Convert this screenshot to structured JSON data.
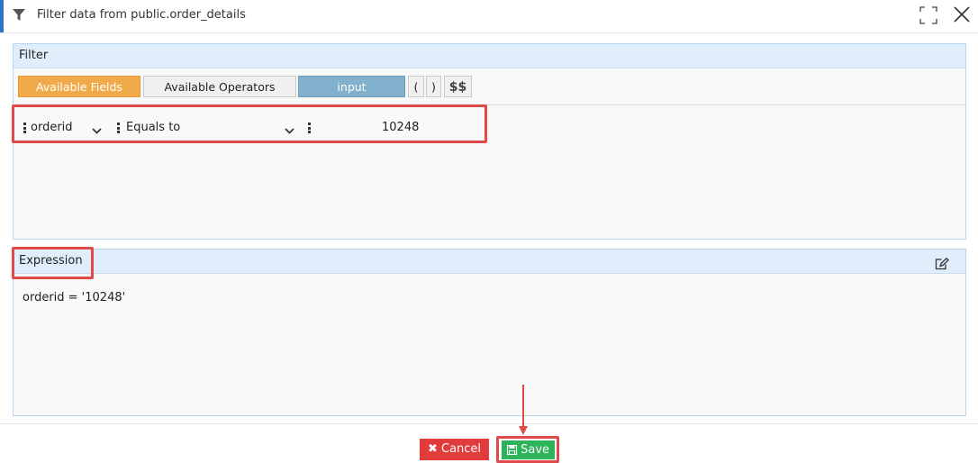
{
  "dialog": {
    "title": "Filter data from public.order_details",
    "accent_color": "#2c73c8"
  },
  "filter": {
    "panel_title": "Filter",
    "toolbar": {
      "available_fields": "Available Fields",
      "available_operators": "Available Operators",
      "input": "input",
      "open_paren": "(",
      "close_paren": ")",
      "dollar_quote": "$$"
    },
    "condition": {
      "field": "orderid",
      "operator": "Equals to",
      "value": "10248"
    }
  },
  "expression": {
    "panel_title": "Expression",
    "text": "orderid = '10248'"
  },
  "footer": {
    "cancel_label": "Cancel",
    "save_label": "Save"
  },
  "icons": {
    "title": "filter-funnel-icon",
    "maximize": "maximize-icon",
    "close": "close-icon",
    "edit": "edit-icon",
    "cancel": "times-icon",
    "save": "floppy-disk-icon"
  },
  "colors": {
    "available_fields_bg": "#f0aa49",
    "input_bg": "#82b1ce",
    "cancel_bg": "#e23b3b",
    "save_bg": "#2db35a",
    "highlight": "#e24a4a"
  }
}
